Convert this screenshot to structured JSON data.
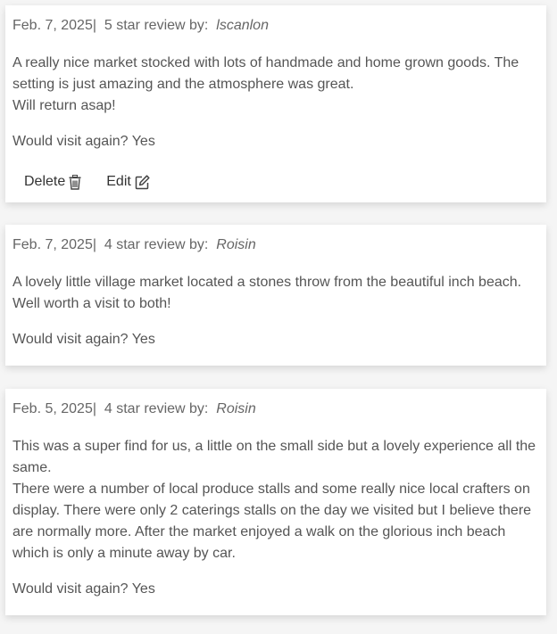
{
  "reviews": [
    {
      "date": "Feb. 7, 2025",
      "separator": "|",
      "rating_text": "5 star review by:",
      "author": "lscanlon",
      "body_lines": [
        "A really nice market stocked with lots of handmade and home grown goods. The setting is just amazing and the atmosphere was great.",
        "Will return asap!"
      ],
      "visit_again": "Would visit again? Yes",
      "actions": {
        "delete_label": "Delete",
        "edit_label": "Edit"
      }
    },
    {
      "date": "Feb. 7, 2025",
      "separator": "|",
      "rating_text": "4 star review by:",
      "author": "Roisin",
      "body_lines": [
        "A lovely little village market located a stones throw from the beautiful inch beach. Well worth a visit to both!"
      ],
      "visit_again": "Would visit again? Yes"
    },
    {
      "date": "Feb. 5, 2025",
      "separator": "|",
      "rating_text": "4 star review by:",
      "author": "Roisin",
      "body_lines": [
        "This was a super find for us, a little on the small side but a lovely experience all the same.",
        "There were a number of local produce stalls and some really nice local crafters on display. There were only 2 caterings stalls on the day we visited but I believe there are normally more. After the market enjoyed a walk on the glorious inch beach which is only a minute away by car."
      ],
      "visit_again": "Would visit again? Yes"
    }
  ],
  "icons": {
    "delete": "trash-icon",
    "edit": "edit-icon"
  }
}
